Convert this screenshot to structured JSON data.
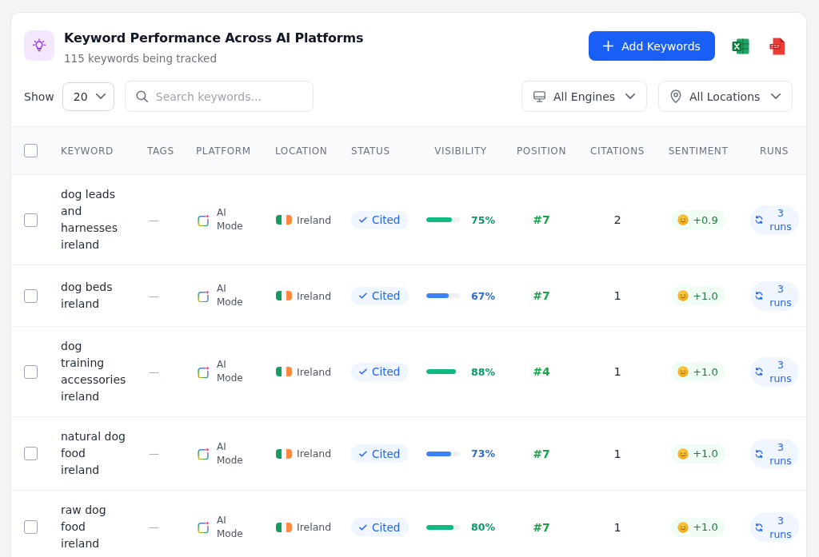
{
  "header": {
    "title": "Keyword Performance Across AI Platforms",
    "subtitle": "115 keywords being tracked",
    "add_button": "Add Keywords"
  },
  "toolbar": {
    "show_label": "Show",
    "page_size": "20",
    "search": {
      "placeholder": "Search keywords..."
    },
    "filters": [
      {
        "kind": "engine",
        "label": "All Engines"
      },
      {
        "kind": "location",
        "label": "All Locations"
      }
    ]
  },
  "table": {
    "select_all_checked": false,
    "columns": [
      "KEYWORD",
      "TAGS",
      "PLATFORM",
      "LOCATION",
      "STATUS",
      "VISIBILITY",
      "POSITION",
      "CITATIONS",
      "SENTIMENT",
      "RUNS"
    ],
    "rows": [
      {
        "checked": false,
        "keyword": "dog leads and harnesses ireland",
        "tags": "—",
        "platform": "AI Mode",
        "location": "Ireland",
        "status": "Cited",
        "visibility": {
          "level": 0.75,
          "reading": "75%",
          "color": "#10b981"
        },
        "position": "#7",
        "citations": "2",
        "sentiment": "+0.9",
        "runs": "3 runs"
      },
      {
        "checked": false,
        "keyword": "dog beds ireland",
        "tags": "—",
        "platform": "AI Mode",
        "location": "Ireland",
        "status": "Cited",
        "visibility": {
          "level": 0.67,
          "reading": "67%",
          "color": "#3b82f6"
        },
        "position": "#7",
        "citations": "1",
        "sentiment": "+1.0",
        "runs": "3 runs"
      },
      {
        "checked": false,
        "keyword": "dog training accessories ireland",
        "tags": "—",
        "platform": "AI Mode",
        "location": "Ireland",
        "status": "Cited",
        "visibility": {
          "level": 0.88,
          "reading": "88%",
          "color": "#10b981"
        },
        "position": "#4",
        "citations": "1",
        "sentiment": "+1.0",
        "runs": "3 runs"
      },
      {
        "checked": false,
        "keyword": "natural dog food ireland",
        "tags": "—",
        "platform": "AI Mode",
        "location": "Ireland",
        "status": "Cited",
        "visibility": {
          "level": 0.73,
          "reading": "73%",
          "color": "#3b82f6"
        },
        "position": "#7",
        "citations": "1",
        "sentiment": "+1.0",
        "runs": "3 runs"
      },
      {
        "checked": false,
        "keyword": "raw dog food ireland",
        "tags": "—",
        "platform": "AI Mode",
        "location": "Ireland",
        "status": "Cited",
        "visibility": {
          "level": 0.8,
          "reading": "80%",
          "color": "#10b981"
        },
        "position": "#7",
        "citations": "1",
        "sentiment": "+1.0",
        "runs": "3 runs"
      }
    ]
  }
}
